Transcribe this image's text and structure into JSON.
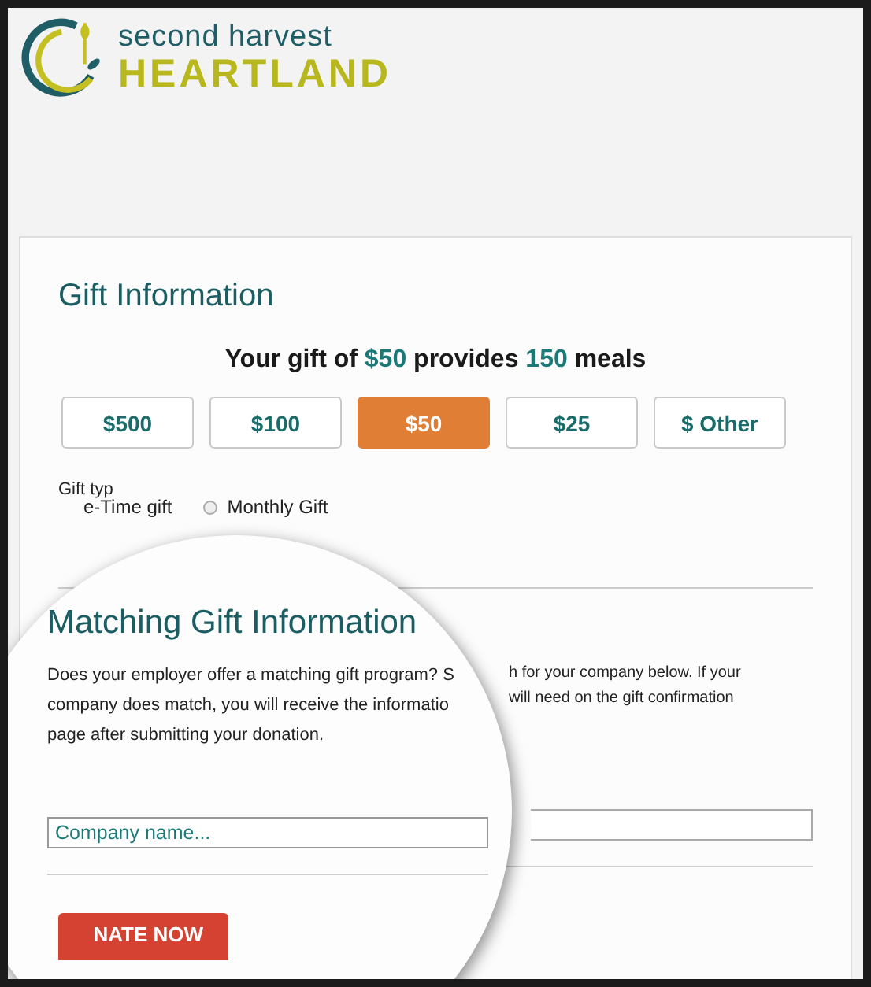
{
  "logo": {
    "line_1": "second harvest",
    "line_2": "HEARTLAND"
  },
  "gift_section": {
    "title": "Gift Information",
    "summary": {
      "before": "Your gift of",
      "amount": "$50",
      "middle": "provides",
      "meals": "150",
      "after": "meals"
    },
    "amounts": [
      {
        "label": "$500",
        "selected": false
      },
      {
        "label": "$100",
        "selected": false
      },
      {
        "label": "$50",
        "selected": true
      },
      {
        "label": "$25",
        "selected": false
      },
      {
        "label": "$ Other",
        "selected": false
      }
    ],
    "gift_type": {
      "label": "Gift typ",
      "partial_option": "e-Time gift",
      "options": [
        {
          "label": "Monthly Gift",
          "selected": false
        }
      ]
    }
  },
  "matching_section": {
    "title": "Matching Gift Information",
    "magnified_lines": [
      "Does your employer offer a matching gift program? S",
      "company does match, you will receive the informatio",
      "page after submitting your donation."
    ],
    "outside_lines": [
      "h for your company below.  If your",
      "will need on the gift confirmation"
    ],
    "field": {
      "placeholder": "Company name..."
    }
  },
  "donate_button": "NATE NOW"
}
